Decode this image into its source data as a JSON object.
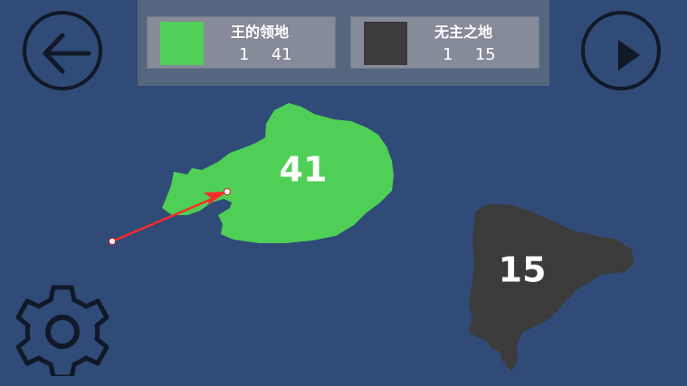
{
  "colors": {
    "background": "#304b78",
    "panel": "#55667f",
    "card": "#858b98",
    "player_territory": "#4fcf55",
    "neutral_territory": "#3b3b3b",
    "arrow": "#ff2a2a",
    "icon_stroke": "#111827"
  },
  "top_panel": {
    "players": [
      {
        "name": "王的领地",
        "territories": "1",
        "troops": "41",
        "color": "#4fcf55"
      },
      {
        "name": "无主之地",
        "territories": "1",
        "troops": "15",
        "color": "#3b3b3b"
      }
    ]
  },
  "map": {
    "territories": [
      {
        "owner": "王的领地",
        "label": "41",
        "color": "#4fcf55"
      },
      {
        "owner": "无主之地",
        "label": "15",
        "color": "#3b3b3b"
      }
    ],
    "attack_arrow": {
      "color": "#ff2a2a"
    }
  },
  "controls": {
    "back_icon": "arrow-left-icon",
    "play_icon": "play-icon",
    "settings_icon": "gear-icon"
  }
}
